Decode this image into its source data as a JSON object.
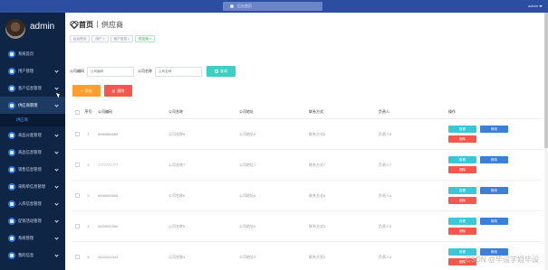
{
  "topbar": {
    "center_text": "后台首页",
    "user": "admin"
  },
  "brand": {
    "name": "admin"
  },
  "sidebar": {
    "items": [
      {
        "label": "系统首页",
        "expandable": false,
        "active": false
      },
      {
        "label": "用户管理",
        "expandable": true,
        "active": false
      },
      {
        "label": "客户信息管理",
        "expandable": true,
        "active": false
      },
      {
        "label": "供应商管理",
        "expandable": true,
        "active": true
      },
      {
        "label": "商品分类管理",
        "expandable": true,
        "active": false
      },
      {
        "label": "商品信息管理",
        "expandable": true,
        "active": false
      },
      {
        "label": "销售信息管理",
        "expandable": true,
        "active": false
      },
      {
        "label": "采购单信息管理",
        "expandable": true,
        "active": false
      },
      {
        "label": "入库信息管理",
        "expandable": true,
        "active": false
      },
      {
        "label": "促销活动管理",
        "expandable": true,
        "active": false
      },
      {
        "label": "系统管理",
        "expandable": true,
        "active": false
      },
      {
        "label": "我的信息",
        "expandable": true,
        "active": false
      }
    ],
    "sub_item": "供应商"
  },
  "page": {
    "home": "首页",
    "current": "供应商",
    "tags": [
      {
        "label": "后台首页",
        "active": false
      },
      {
        "label": "用户 ×",
        "active": false
      },
      {
        "label": "客户信息 ×",
        "active": false
      },
      {
        "label": "供应商 ×",
        "active": true
      }
    ]
  },
  "search": {
    "code_label": "公司编码",
    "code_placeholder": "公司编码",
    "name_label": "公司名称",
    "name_placeholder": "公司名称",
    "button": "查询"
  },
  "actions": {
    "add": "添加",
    "delete": "删除",
    "add_glyph": "+",
    "delete_glyph": "▥"
  },
  "table": {
    "columns": [
      "序号",
      "公司编码",
      "公司名称",
      "公司地址",
      "联系方式",
      "负责人",
      "操作"
    ],
    "rows": [
      {
        "index": "1",
        "code": "8888888888",
        "name": "公司名称8",
        "address": "公司地址8",
        "phone": "联系方式8",
        "person": "负责人8"
      },
      {
        "index": "2",
        "code": "7777777777",
        "name": "公司名称7",
        "address": "公司地址7",
        "phone": "联系方式7",
        "person": "负责人7"
      },
      {
        "index": "3",
        "code": "6666666666",
        "name": "公司名称6",
        "address": "公司地址6",
        "phone": "联系方式6",
        "person": "负责人6"
      },
      {
        "index": "4",
        "code": "5555555555",
        "name": "公司名称5",
        "address": "公司地址5",
        "phone": "联系方式5",
        "person": "负责人5"
      },
      {
        "index": "5",
        "code": "4444444444",
        "name": "公司名称4",
        "address": "公司地址4",
        "phone": "联系方式4",
        "person": "负责人4"
      }
    ],
    "ops": {
      "view": "查看",
      "edit": "修改",
      "delete": "删除"
    }
  },
  "watermark": "CSDN @毕设学姐毕设",
  "colors": {
    "topbar": "#2c4ea0",
    "sidebar": "#0f2545",
    "search_button": "#3ad0c4",
    "add_button": "#ff9d2d",
    "delete_button": "#f5574e",
    "view_button": "#3ac8d4",
    "edit_button": "#3d7fd6"
  }
}
